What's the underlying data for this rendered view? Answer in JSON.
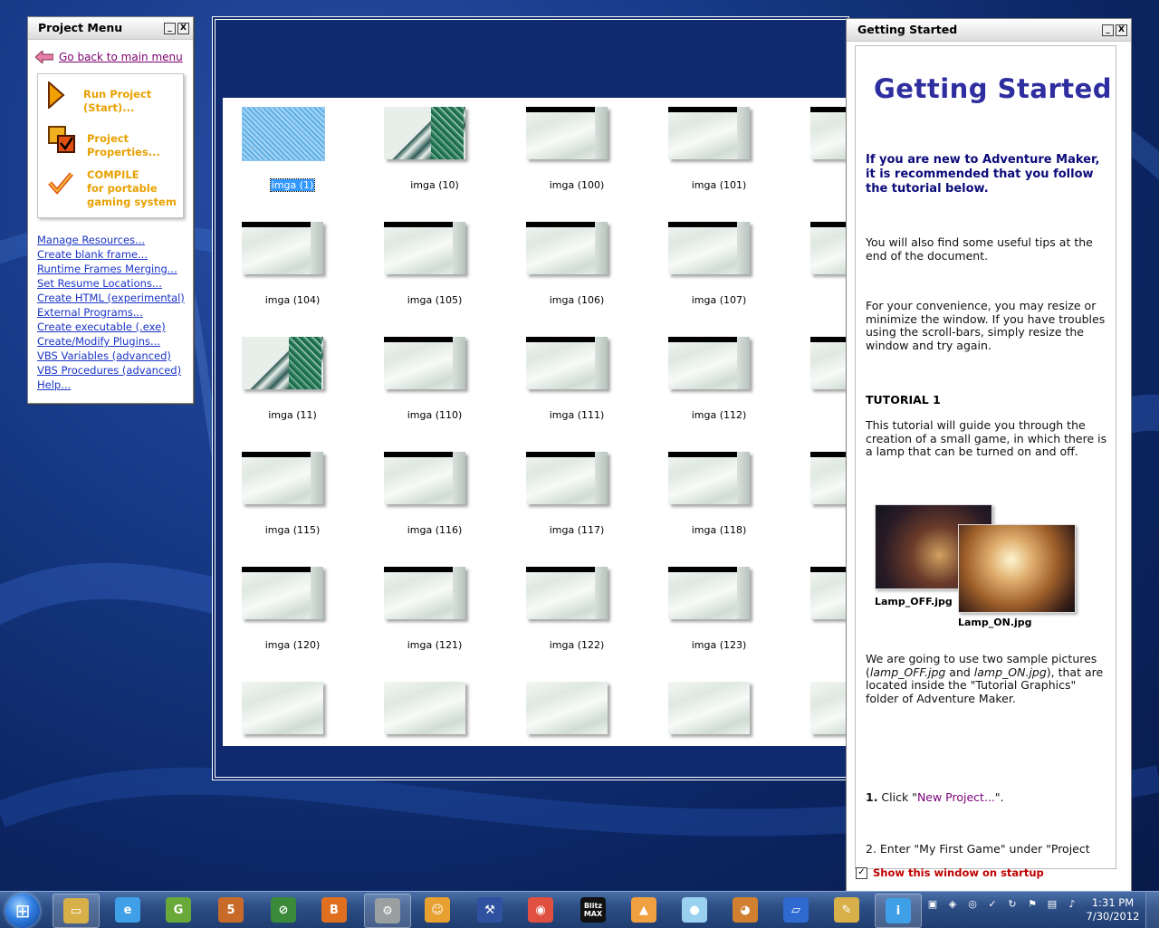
{
  "project_menu": {
    "title": "Project Menu",
    "min_btn": "_",
    "close_btn": "X",
    "back_link": "Go back to main menu",
    "run_project": "Run Project\n(Start)...",
    "project_properties": "Project\nProperties...",
    "compile": "COMPILE\nfor portable\ngaming system",
    "links": [
      "Manage Resources...",
      "Create blank frame...",
      "Runtime Frames Merging...",
      "Set Resume Locations...",
      "Create HTML (experimental)",
      "External Programs...",
      "Create executable (.exe)",
      "Create/Modify Plugins...",
      "VBS Variables (advanced)",
      "VBS Procedures (advanced)",
      "Help..."
    ]
  },
  "frames": {
    "rows": [
      [
        "imga (1)",
        "imga (10)",
        "imga (100)",
        "imga (101)",
        "in"
      ],
      [
        "imga (104)",
        "imga (105)",
        "imga (106)",
        "imga (107)",
        "in"
      ],
      [
        "imga (11)",
        "imga (110)",
        "imga (111)",
        "imga (112)",
        "in"
      ],
      [
        "imga (115)",
        "imga (116)",
        "imga (117)",
        "imga (118)",
        "in"
      ],
      [
        "imga (120)",
        "imga (121)",
        "imga (122)",
        "imga (123)",
        "in"
      ],
      [
        "",
        "",
        "",
        "",
        ""
      ]
    ],
    "selected": "imga (1)"
  },
  "getting_started": {
    "title": "Getting Started",
    "min_btn": "_",
    "close_btn": "X",
    "heading": "Getting Started",
    "intro_bold": "If you are new to Adventure Maker, it is recommended that you follow the tutorial below.",
    "tips": "You will also find some useful tips at the end of the document.",
    "resize": "For your convenience, you may resize or minimize the window. If you have troubles using the scroll-bars, simply resize the window and try again.",
    "tutorial_heading": "TUTORIAL 1",
    "tutorial_text": "This tutorial will guide you through the creation of a small game, in which there is a lamp that can be turned on and off.",
    "img_off_caption": "Lamp_OFF.jpg",
    "img_on_caption": "Lamp_ON.jpg",
    "samples_pre": "We are going to use two sample pictures (",
    "samples_off": "lamp_OFF.jpg",
    "samples_and": " and ",
    "samples_on": "lamp_ON.jpg",
    "samples_post": "), that are located inside the \"Tutorial Graphics\" folder of Adventure Maker.",
    "step1_num": "1.",
    "step1_pre": " Click \"",
    "step1_link": "New Project...",
    "step1_post": "\".",
    "step2": "2. Enter \"My First Game\" under \"Project",
    "show_on_startup": "Show this window on startup",
    "checkbox_mark": "✓"
  },
  "taskbar": {
    "apps": [
      "G",
      "5",
      "⊘",
      "B",
      "⚙",
      "☺",
      "⚒",
      "◉",
      "Blitz\nMAX",
      "▲",
      "●",
      "◕",
      "▱",
      "✎",
      "i"
    ],
    "time": "1:31 PM",
    "date": "7/30/2012"
  },
  "colors": {
    "link_blue": "#1a33c8",
    "menu_orange": "#e8a100",
    "heading_blue": "#2e2ea0",
    "startup_red": "#c00000"
  }
}
